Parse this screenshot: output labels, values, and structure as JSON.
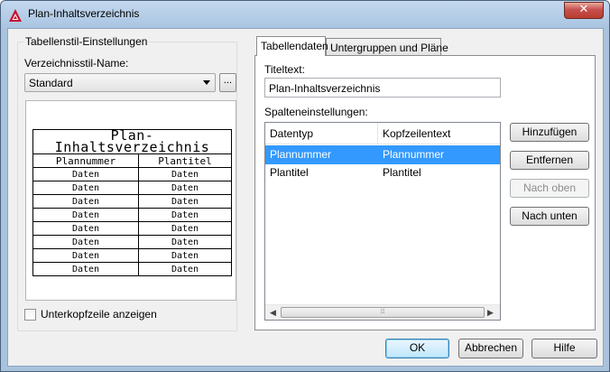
{
  "window": {
    "title": "Plan-Inhaltsverzeichnis",
    "close_label": "✕"
  },
  "left": {
    "group_title": "Tabellenstil-Einstellungen",
    "style_label": "Verzeichnisstil-Name:",
    "style_value": "Standard",
    "browse_label": "...",
    "preview": {
      "title": "Plan-Inhaltsverzeichnis",
      "headers": [
        "Plannummer",
        "Plantitel"
      ],
      "rows": [
        [
          "Daten",
          "Daten"
        ],
        [
          "Daten",
          "Daten"
        ],
        [
          "Daten",
          "Daten"
        ],
        [
          "Daten",
          "Daten"
        ],
        [
          "Daten",
          "Daten"
        ],
        [
          "Daten",
          "Daten"
        ],
        [
          "Daten",
          "Daten"
        ],
        [
          "Daten",
          "Daten"
        ]
      ]
    },
    "subheader_label": "Unterkopfzeile anzeigen",
    "subheader_checked": false
  },
  "tabs": [
    {
      "label": "Tabellendaten",
      "active": true
    },
    {
      "label": "Untergruppen und Pläne",
      "active": false
    }
  ],
  "tab_data": {
    "title_label": "Titeltext:",
    "title_value": "Plan-Inhaltsverzeichnis",
    "columns_label": "Spalteneinstellungen:",
    "list_headers": [
      "Datentyp",
      "Kopfzeilentext"
    ],
    "list_rows": [
      {
        "type": "Plannummer",
        "header": "Plannummer",
        "selected": true
      },
      {
        "type": "Plantitel",
        "header": "Plantitel",
        "selected": false
      }
    ],
    "buttons": {
      "add": "Hinzufügen",
      "remove": "Entfernen",
      "up": "Nach oben",
      "down": "Nach unten"
    }
  },
  "footer": {
    "ok": "OK",
    "cancel": "Abbrechen",
    "help": "Hilfe"
  },
  "colors": {
    "selection": "#3399ff",
    "app_icon": "#c8102e"
  }
}
